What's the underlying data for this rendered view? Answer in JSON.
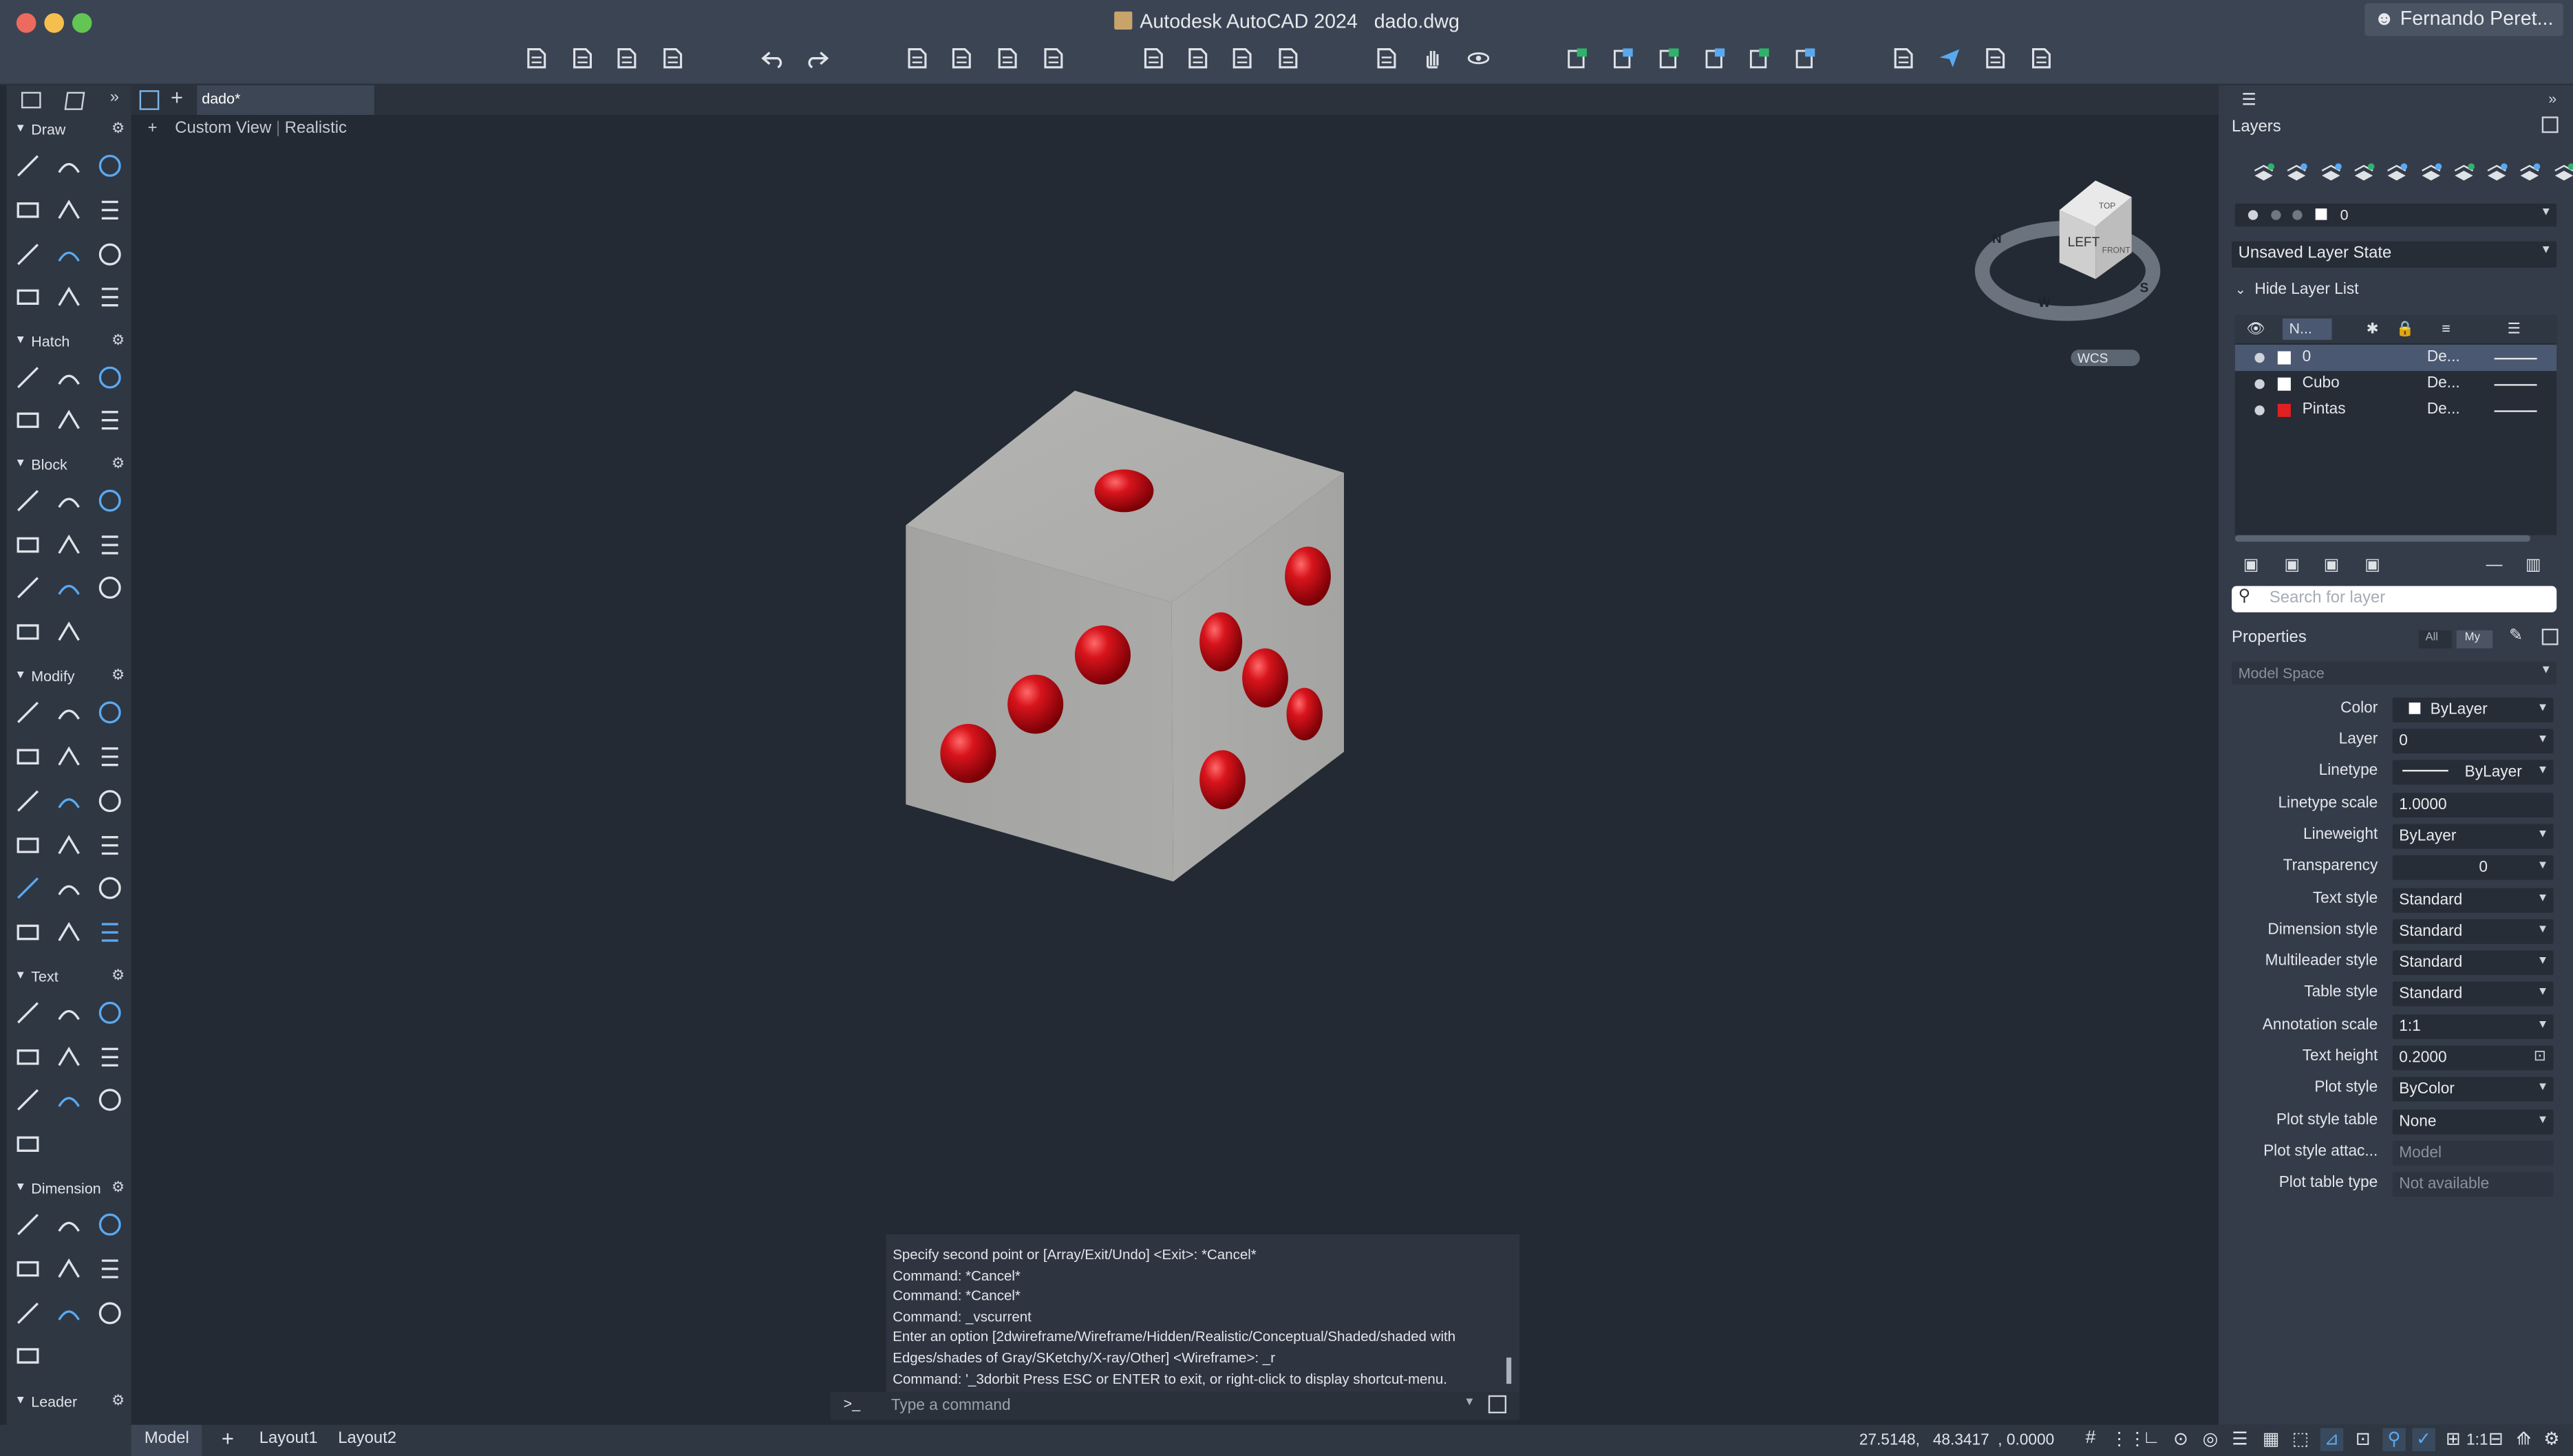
{
  "titlebar": {
    "app_title": "Autodesk AutoCAD 2024",
    "file_name": "dado.dwg",
    "user": "Fernando Peret..."
  },
  "doc_tab": {
    "label": "dado*"
  },
  "viewport": {
    "view_label": "Custom View",
    "style_label": "Realistic",
    "plus": "+"
  },
  "viewcube": {
    "face_top": "TOP",
    "face_left": "LEFT",
    "face_front": "FRONT",
    "compass_n": "N",
    "compass_w": "W",
    "compass_s": "S",
    "wcs": "WCS"
  },
  "palette": {
    "sections": [
      "Draw",
      "Hatch",
      "Block",
      "Modify",
      "Text",
      "Dimension",
      "Leader"
    ]
  },
  "layers": {
    "title": "Layers",
    "current_layer": "0",
    "layer_state": "Unsaved Layer State",
    "hide_list": "Hide Layer List",
    "col_name": "N...",
    "rows": [
      {
        "name": "0",
        "desc": "De...",
        "color": "#ffffff"
      },
      {
        "name": "Cubo",
        "desc": "De...",
        "color": "#ffffff"
      },
      {
        "name": "Pintas",
        "desc": "De...",
        "color": "#e02020"
      }
    ],
    "search_placeholder": "Search for layer"
  },
  "properties": {
    "title": "Properties",
    "filter_all": "All",
    "filter_my": "My",
    "scope": "Model Space",
    "rows": [
      {
        "label": "Color",
        "value": "ByLayer"
      },
      {
        "label": "Layer",
        "value": "0"
      },
      {
        "label": "Linetype",
        "value": "ByLayer"
      },
      {
        "label": "Linetype scale",
        "value": "1.0000"
      },
      {
        "label": "Lineweight",
        "value": "ByLayer"
      },
      {
        "label": "Transparency",
        "value": "0"
      },
      {
        "label": "Text style",
        "value": "Standard"
      },
      {
        "label": "Dimension style",
        "value": "Standard"
      },
      {
        "label": "Multileader style",
        "value": "Standard"
      },
      {
        "label": "Table style",
        "value": "Standard"
      },
      {
        "label": "Annotation scale",
        "value": "1:1"
      },
      {
        "label": "Text height",
        "value": "0.2000"
      },
      {
        "label": "Plot style",
        "value": "ByColor"
      },
      {
        "label": "Plot style table",
        "value": "None"
      },
      {
        "label": "Plot style attac...",
        "value": "Model"
      },
      {
        "label": "Plot table type",
        "value": "Not available"
      }
    ]
  },
  "command": {
    "history": [
      "Specify second point or [Array/Exit/Undo] <Exit>: *Cancel*",
      "Command: *Cancel*",
      "Command: *Cancel*",
      "Command: _vscurrent",
      "Enter an option [2dwireframe/Wireframe/Hidden/Realistic/Conceptual/Shaded/shaded with",
      "Edges/shades of Gray/SKetchy/X-ray/Other] <Wireframe>: _r",
      "Command: '_3dorbit Press ESC or ENTER to exit, or right-click to display shortcut-menu."
    ],
    "prompt_symbol": ">_",
    "placeholder": "Type a command"
  },
  "statusbar": {
    "tabs": [
      "Model",
      "Layout1",
      "Layout2"
    ],
    "coords": "27.5148,   48.3417  , 0.0000",
    "scale": "1:1"
  },
  "colors": {
    "accent_blue": "#3b8fd9",
    "pip_red": "#d0121b",
    "die_gray": "#a8a8a6"
  }
}
